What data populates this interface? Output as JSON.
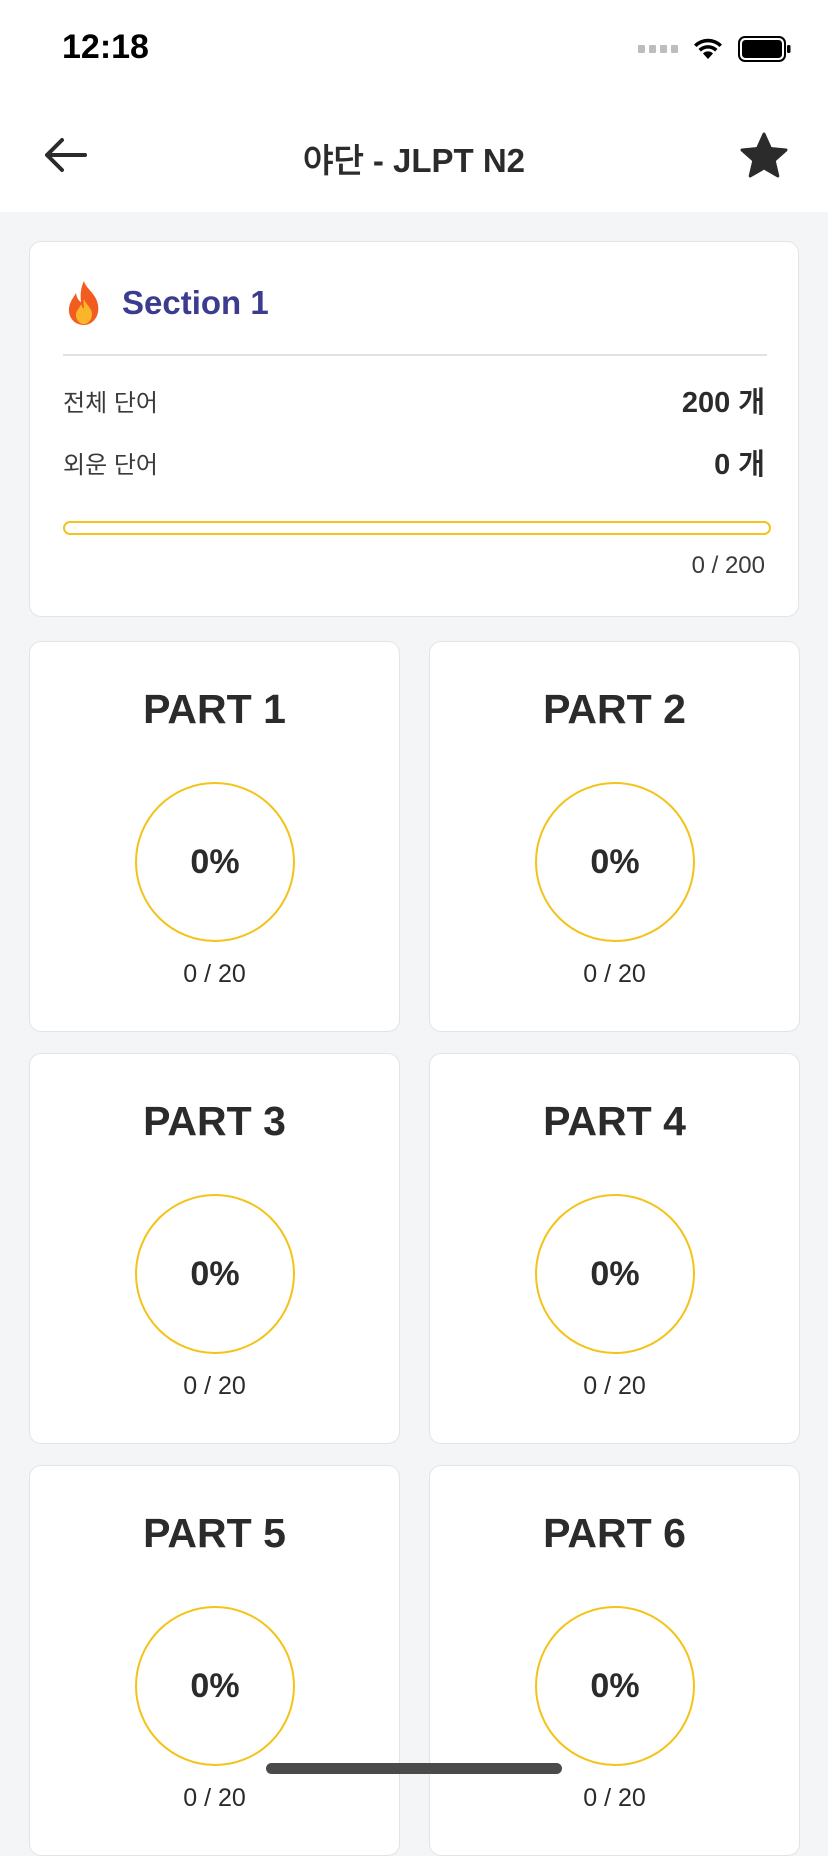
{
  "status_bar": {
    "time": "12:18"
  },
  "nav": {
    "title": "야단 - JLPT N2"
  },
  "section": {
    "title": "Section 1",
    "total_label": "전체 단어",
    "total_value": "200 개",
    "learned_label": "외운 단어",
    "learned_value": "0 개",
    "progress_text": "0 / 200",
    "progress_fraction": 0
  },
  "parts": [
    {
      "title": "PART 1",
      "percent": "0%",
      "count": "0 / 20"
    },
    {
      "title": "PART 2",
      "percent": "0%",
      "count": "0 / 20"
    },
    {
      "title": "PART 3",
      "percent": "0%",
      "count": "0 / 20"
    },
    {
      "title": "PART 4",
      "percent": "0%",
      "count": "0 / 20"
    },
    {
      "title": "PART 5",
      "percent": "0%",
      "count": "0 / 20"
    },
    {
      "title": "PART 6",
      "percent": "0%",
      "count": "0 / 20"
    }
  ],
  "colors": {
    "accent": "#f4c31a",
    "section_title": "#3b3b8f",
    "background": "#f4f5f6"
  },
  "icons": {
    "back": "arrow-left-icon",
    "favorite": "star-icon",
    "section": "fire-icon"
  }
}
